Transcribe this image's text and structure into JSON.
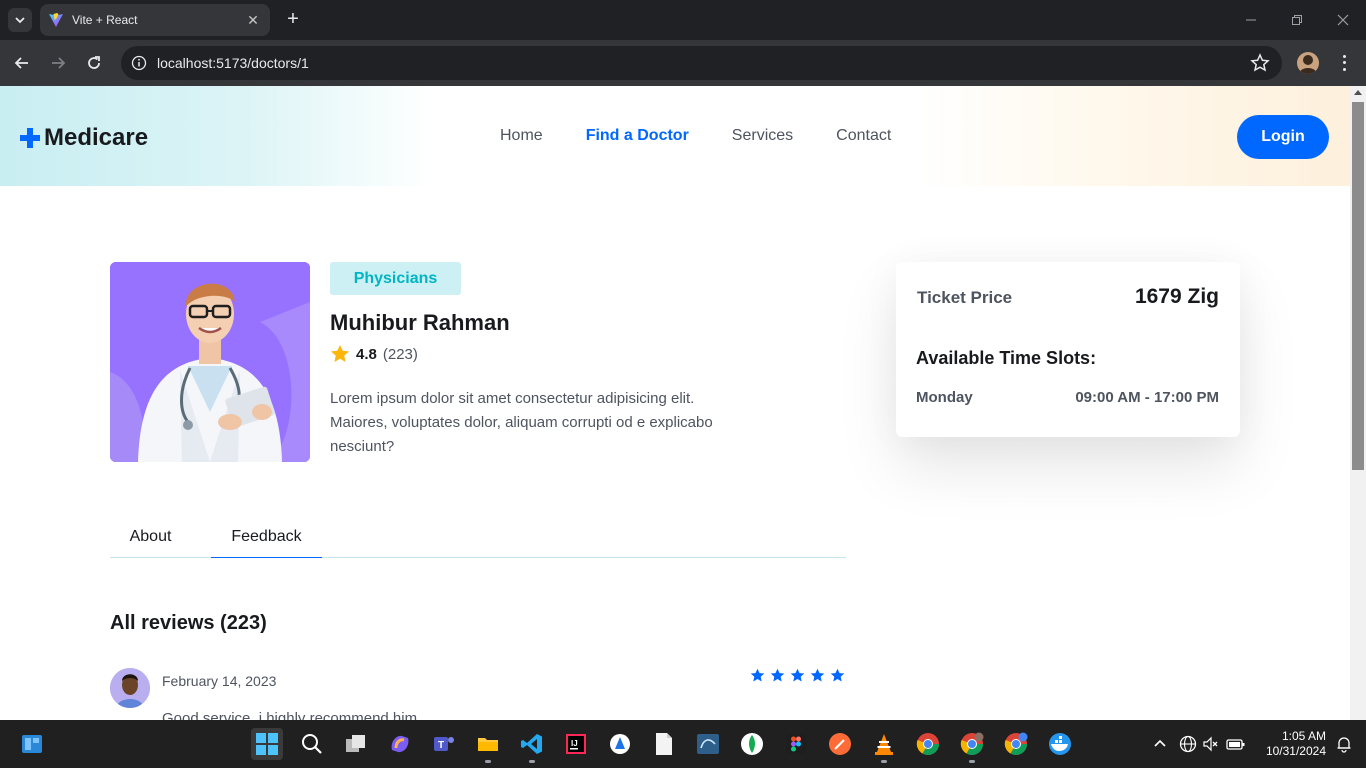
{
  "browser": {
    "tab_title": "Vite + React",
    "url": "localhost:5173/doctors/1"
  },
  "site": {
    "logo": "Medicare",
    "nav": [
      {
        "label": "Home",
        "active": false
      },
      {
        "label": "Find a Doctor",
        "active": true
      },
      {
        "label": "Services",
        "active": false
      },
      {
        "label": "Contact",
        "active": false
      }
    ],
    "login_label": "Login"
  },
  "doctor": {
    "specialty": "Physicians",
    "name": "Muhibur Rahman",
    "rating": "4.8",
    "rating_count": "(223)",
    "bio": "Lorem ipsum dolor sit amet consectetur adipisicing elit. Maiores, voluptates dolor, aliquam corrupti od e explicabo nesciunt?"
  },
  "tabs": [
    {
      "label": "About",
      "active": false
    },
    {
      "label": "Feedback",
      "active": true
    }
  ],
  "reviews": {
    "title": "All reviews (223)",
    "items": [
      {
        "date": "February 14, 2023",
        "text": "Good service, i highly recommend him",
        "stars": 5
      }
    ]
  },
  "booking": {
    "price_label": "Ticket Price",
    "price_value": "1679 Zig",
    "slots_title": "Available Time Slots:",
    "slots": [
      {
        "day": "Monday",
        "time": "09:00 AM - 17:00 PM"
      }
    ]
  },
  "taskbar": {
    "time": "1:05 AM",
    "date": "10/31/2024"
  },
  "colors": {
    "primary": "#0067ff",
    "teal": "#01b5c5",
    "purple": "#9771ff",
    "star_yellow": "#feb60d"
  }
}
